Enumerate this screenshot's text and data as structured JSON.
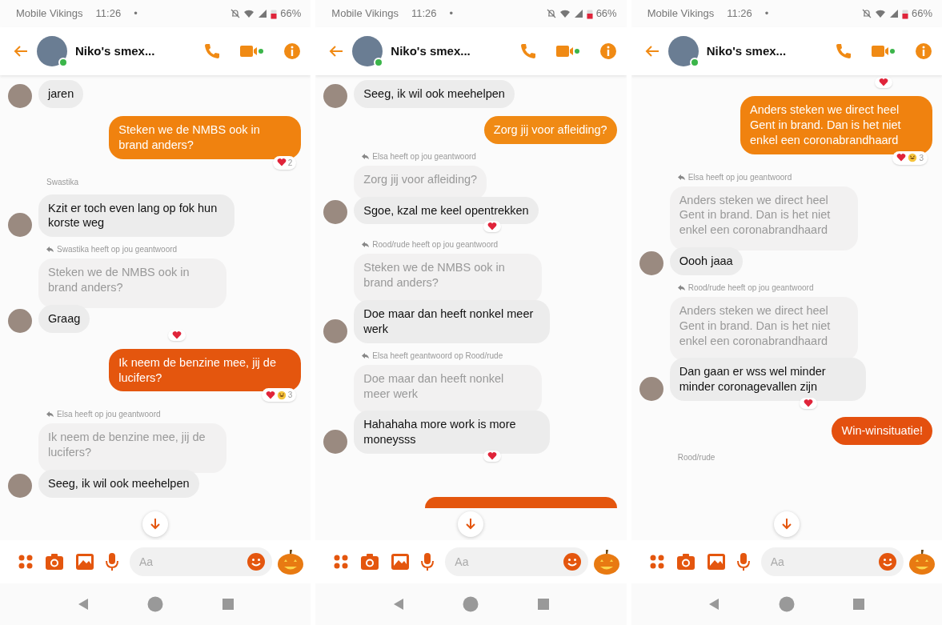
{
  "screens": [
    {
      "status": {
        "carrier": "Mobile Vikings",
        "time": "11:26",
        "dot": "•",
        "battery": "66%"
      },
      "header": {
        "title": "Niko's smex...",
        "online": true
      },
      "messages": [
        {
          "kind": "received",
          "text": "jaren",
          "avatar": true
        },
        {
          "kind": "sent",
          "text": "Steken we de NMBS ook in brand anders?",
          "color": "#f0820f",
          "reactions": {
            "items": [
              {
                "kind": "heart"
              }
            ],
            "count": "2"
          }
        },
        {
          "kind": "sender",
          "text": "Swastika"
        },
        {
          "kind": "received",
          "text": "Kzit er toch even lang op fok hun korste weg",
          "avatar": true
        },
        {
          "kind": "reply",
          "text": "Swastika heeft op jou geantwoord"
        },
        {
          "kind": "quote",
          "text": "Steken we de NMBS ook in brand anders?"
        },
        {
          "kind": "received",
          "text": "Graag",
          "avatar": true,
          "reactions": {
            "items": [
              {
                "kind": "heart"
              }
            ]
          }
        },
        {
          "kind": "sent",
          "text": "Ik neem de benzine mee, jij de lucifers?",
          "color": "#e4560e",
          "reactions": {
            "items": [
              {
                "kind": "heart"
              },
              {
                "kind": "laugh"
              }
            ],
            "count": "3"
          }
        },
        {
          "kind": "reply",
          "text": "Elsa heeft op jou geantwoord"
        },
        {
          "kind": "quote",
          "text": "Ik neem de benzine mee, jij de lucifers?"
        },
        {
          "kind": "received",
          "text": "Seeg, ik wil ook meehelpen",
          "avatar": true
        }
      ],
      "composer": {
        "placeholder": "Aa"
      }
    },
    {
      "status": {
        "carrier": "Mobile Vikings",
        "time": "11:26",
        "dot": "•",
        "battery": "66%"
      },
      "header": {
        "title": "Niko's smex...",
        "online": true
      },
      "messages": [
        {
          "kind": "received",
          "text": "Seeg, ik wil ook meehelpen",
          "avatar": true
        },
        {
          "kind": "sent",
          "text": "Zorg jij voor afleiding?",
          "color": "#f08a14"
        },
        {
          "kind": "reply",
          "text": "Elsa heeft op jou geantwoord"
        },
        {
          "kind": "quote",
          "text": "Zorg jij voor afleiding?"
        },
        {
          "kind": "received",
          "text": "Sgoe, kzal me keel opentrekken",
          "avatar": true,
          "reactions": {
            "items": [
              {
                "kind": "heart"
              }
            ]
          }
        },
        {
          "kind": "reply",
          "text": "Rood/rude heeft op jou geantwoord"
        },
        {
          "kind": "quote",
          "text": "Steken we de NMBS ook in brand anders?"
        },
        {
          "kind": "received",
          "text": "Doe maar dan heeft nonkel meer werk",
          "avatar": true
        },
        {
          "kind": "reply",
          "text": "Elsa heeft geantwoord op Rood/rude"
        },
        {
          "kind": "quote",
          "text": "Doe maar dan heeft nonkel meer werk"
        },
        {
          "kind": "received",
          "text": "Hahahaha more work is more moneysss",
          "avatar": true,
          "reactions": {
            "items": [
              {
                "kind": "heart"
              }
            ]
          }
        },
        {
          "kind": "sent_cut",
          "color": "#e4560e"
        }
      ],
      "composer": {
        "placeholder": "Aa"
      }
    },
    {
      "status": {
        "carrier": "Mobile Vikings",
        "time": "11:26",
        "dot": "•",
        "battery": "66%"
      },
      "header": {
        "title": "Niko's smex...",
        "online": true
      },
      "messages": [
        {
          "kind": "reaction",
          "reactions": {
            "items": [
              {
                "kind": "heart"
              }
            ]
          }
        },
        {
          "kind": "sent",
          "text": "Anders steken we direct heel Gent in brand. Dan is het niet enkel een coronabrandhaard",
          "color": "#f0820f",
          "reactions": {
            "items": [
              {
                "kind": "heart"
              },
              {
                "kind": "laugh"
              }
            ],
            "count": "3"
          }
        },
        {
          "kind": "reply",
          "text": "Elsa heeft op jou geantwoord"
        },
        {
          "kind": "quote",
          "text": "Anders steken we direct heel Gent in brand. Dan is het niet enkel een coronabrandhaard"
        },
        {
          "kind": "received",
          "text": "Oooh jaaa",
          "avatar": true
        },
        {
          "kind": "reply",
          "text": "Rood/rude heeft op jou geantwoord"
        },
        {
          "kind": "quote",
          "text": "Anders steken we direct heel Gent in brand. Dan is het niet enkel een coronabrandhaard"
        },
        {
          "kind": "received",
          "text": "Dan gaan er wss wel minder minder coronagevallen zijn",
          "avatar": true,
          "reactions": {
            "items": [
              {
                "kind": "heart"
              }
            ]
          }
        },
        {
          "kind": "sent",
          "text": "Win-winsituatie!",
          "color": "#e4500f"
        },
        {
          "kind": "sender",
          "text": "Rood/rude"
        }
      ],
      "composer": {
        "placeholder": "Aa"
      }
    }
  ]
}
